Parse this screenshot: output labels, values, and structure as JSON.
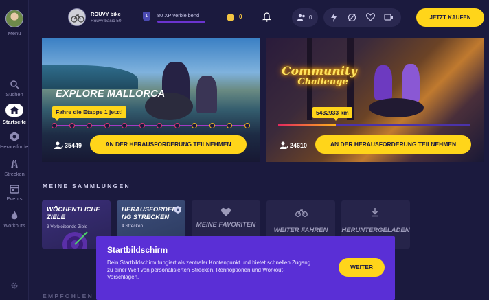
{
  "sidebar": {
    "menu_label": "Menü",
    "items": [
      {
        "label": "Suchen",
        "icon": "search-icon"
      },
      {
        "label": "Startseite",
        "icon": "home-icon"
      },
      {
        "label": "Herausforde...",
        "icon": "challenge-icon"
      },
      {
        "label": "Strecken",
        "icon": "route-icon"
      },
      {
        "label": "Events",
        "icon": "calendar-icon"
      },
      {
        "label": "Workouts",
        "icon": "flame-icon"
      }
    ],
    "settings_icon": "gear-icon"
  },
  "topbar": {
    "bike_name": "ROUVY bike",
    "bike_model": "Rouvy basic 50",
    "level": "1",
    "xp_text": "80 XP verbleibend",
    "coins": "0",
    "friends_count": "0",
    "buy_button": "JETZT KAUFEN"
  },
  "hero": [
    {
      "title": "EXPLORE MALLORCA",
      "callout": "Fahre die Etappe 1 jetzt!",
      "participants": "35449",
      "button": "AN DER HERAUSFORDERUNG TEILNEHMEN",
      "stages_total": 12,
      "stages_highlight_from": 9
    },
    {
      "title_line1": "Community",
      "title_line2": "Challenge",
      "distance": "5432933 km",
      "progress": 0.3,
      "participants": "24610",
      "button": "AN DER HERAUSFORDERUNG TEILNEHMEN"
    }
  ],
  "collections": {
    "title": "MEINE SAMMLUNGEN",
    "items": [
      {
        "title": "WÖCHENTLICHE ZIELE",
        "subtitle": "3 Verbleibende Ziele"
      },
      {
        "title": "HERAUSFORDERU NG STRECKEN",
        "subtitle": "4 Strecken"
      },
      {
        "title": "MEINE FAVORITEN"
      },
      {
        "title": "WEITER FAHREN"
      },
      {
        "title": "HERUNTERGELADEN"
      }
    ]
  },
  "recommended_title": "EMPFOHLEN",
  "dialog": {
    "title": "Startbildschirm",
    "body": "Dein Startbildschirm fungiert als zentraler Knotenpunkt und bietet schnellen Zugang zu einer Welt von personalisierten Strecken, Rennoptionen und Workout-Vorschlägen.",
    "button": "WEITER"
  },
  "colors": {
    "accent": "#ffd51a",
    "background": "#1b1a3e",
    "dialog": "#5a2fd6"
  }
}
